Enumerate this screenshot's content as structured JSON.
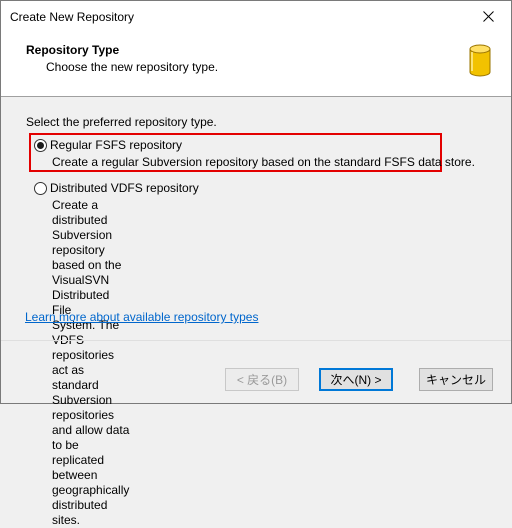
{
  "window": {
    "title": "Create New Repository"
  },
  "header": {
    "title": "Repository Type",
    "subtitle": "Choose the new repository type.",
    "icon": "database-icon"
  },
  "main": {
    "prompt": "Select the preferred repository type.",
    "options": [
      {
        "label": "Regular FSFS repository",
        "description": "Create a regular Subversion repository based on the standard FSFS data store.",
        "selected": true
      },
      {
        "label": "Distributed VDFS repository",
        "description_lines": [
          "Create a distributed Subversion repository based on the VisualSVN Distributed File",
          "System. The VDFS repositories act as standard Subversion repositories and allow data",
          "to be replicated between geographically distributed sites."
        ],
        "selected": false
      }
    ],
    "learn_more_link": "Learn more about available repository types"
  },
  "footer": {
    "back_label": "< 戻る(B)",
    "next_label": "次へ(N) >",
    "cancel_label": "キャンセル"
  },
  "colors": {
    "highlight_border": "#e30000",
    "link": "#0066cc",
    "icon_gold": "#e8b400"
  }
}
